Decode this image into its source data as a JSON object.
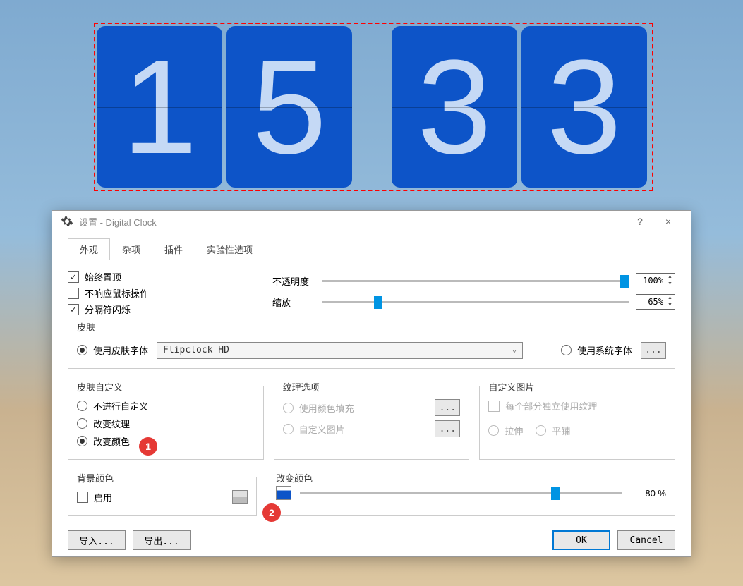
{
  "clock": {
    "d1": "1",
    "d2": "5",
    "d3": "3",
    "d4": "3"
  },
  "dialog": {
    "title": "设置 - Digital Clock",
    "help": "?",
    "close": "×",
    "tabs": [
      "外观",
      "杂项",
      "插件",
      "实验性选项"
    ],
    "checks": {
      "always_top": "始终置顶",
      "ignore_mouse": "不响应鼠标操作",
      "blink_separator": "分隔符闪烁"
    },
    "sliders": {
      "opacity_lbl": "不透明度",
      "opacity_val": "100%",
      "zoom_lbl": "缩放",
      "zoom_val": "65%"
    },
    "skin": {
      "legend": "皮肤",
      "use_skin_font": "使用皮肤字体",
      "combo_value": "Flipclock HD",
      "use_system_font": "使用系统字体",
      "ellipsis": "..."
    },
    "skin_custom": {
      "legend": "皮肤自定义",
      "none": "不进行自定义",
      "texture": "改变纹理",
      "color": "改变颜色"
    },
    "texture_opts": {
      "legend": "纹理选项",
      "fill": "使用颜色填充",
      "image": "自定义图片",
      "ellipsis": "..."
    },
    "custom_img": {
      "legend": "自定义图片",
      "per_part": "每个部分独立使用纹理",
      "stretch": "拉伸",
      "tile": "平铺"
    },
    "bg": {
      "legend": "背景颜色",
      "enable": "启用"
    },
    "chg_color": {
      "legend": "改变颜色",
      "value": "80 %"
    },
    "buttons": {
      "import": "导入...",
      "export": "导出...",
      "ok": "OK",
      "cancel": "Cancel"
    },
    "badges": {
      "b1": "1",
      "b2": "2"
    }
  }
}
